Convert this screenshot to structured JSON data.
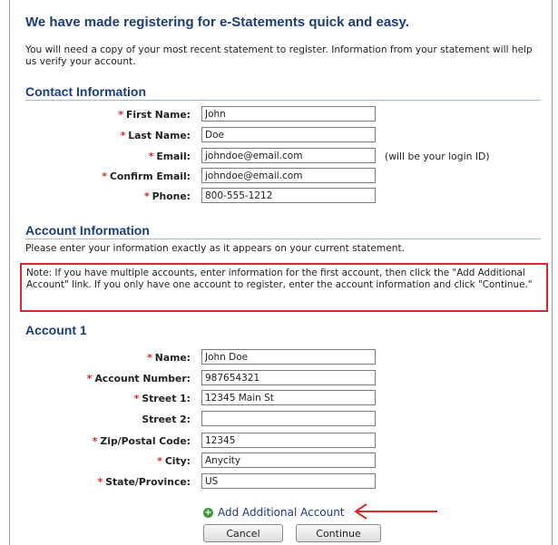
{
  "page": {
    "title": "We have made registering for e-Statements quick and easy.",
    "intro": "You will need a copy of your most recent statement to register. Information from your statement will help us verify your account."
  },
  "contact": {
    "heading": "Contact Information",
    "fields": {
      "first_name": {
        "label": "First Name:",
        "value": "John"
      },
      "last_name": {
        "label": "Last Name:",
        "value": "Doe"
      },
      "email": {
        "label": "Email:",
        "value": "johndoe@email.com",
        "hint": "(will be your login ID)"
      },
      "confirm_email": {
        "label": "Confirm Email:",
        "value": "johndoe@email.com"
      },
      "phone": {
        "label": "Phone:",
        "value": "800-555-1212"
      }
    }
  },
  "account_info": {
    "heading": "Account Information",
    "instruction": "Please enter your information exactly as it appears on your current statement.",
    "note": "Note: If you have multiple accounts, enter information for the first account, then click the \"Add Additional Account\" link. If you only have one account to register, enter the account information and click \"Continue.\""
  },
  "account1": {
    "heading": "Account 1",
    "fields": {
      "name": {
        "label": "Name:",
        "value": "John Doe"
      },
      "account_number": {
        "label": "Account Number:",
        "value": "987654321"
      },
      "street1": {
        "label": "Street 1:",
        "value": "12345 Main St"
      },
      "street2": {
        "label": "Street 2:",
        "value": ""
      },
      "zip": {
        "label": "Zip/Postal Code:",
        "value": "12345"
      },
      "city": {
        "label": "City:",
        "value": "Anycity"
      },
      "state": {
        "label": "State/Province:",
        "value": "US"
      }
    }
  },
  "actions": {
    "add_account": "Add Additional Account",
    "cancel": "Cancel",
    "continue": "Continue"
  },
  "required_marker": "*",
  "colors": {
    "heading": "#1c3d78",
    "required": "#d8262c",
    "highlight": "#d8262c",
    "add_icon": "#3d9b3a"
  }
}
